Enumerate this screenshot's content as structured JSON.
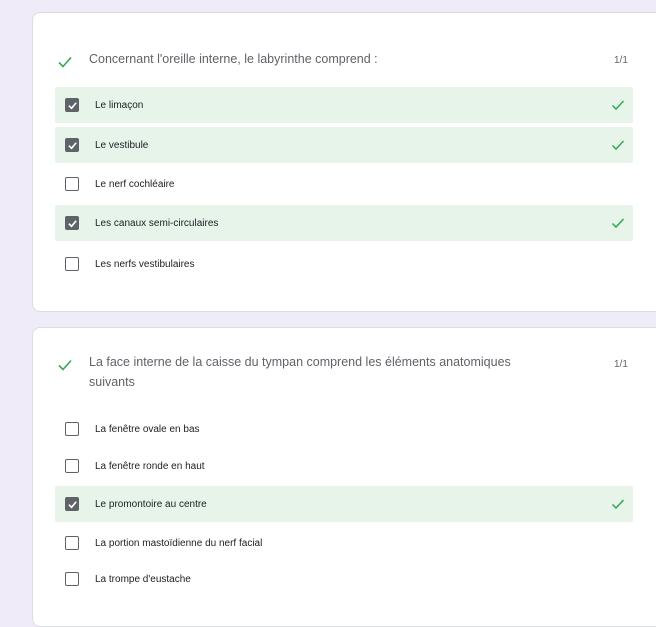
{
  "colors": {
    "correct_bg": "#e6f4ea",
    "check_green": "#34a853",
    "page_bg": "#f0ebf8"
  },
  "questions": [
    {
      "text": "Concernant l'oreille interne, le labyrinthe comprend :",
      "score": "1/1",
      "status_icon": "check-icon",
      "options": [
        {
          "label": "Le limaçon",
          "checked": true,
          "correct": true
        },
        {
          "label": "Le vestibule",
          "checked": true,
          "correct": true
        },
        {
          "label": "Le nerf cochléaire",
          "checked": false,
          "correct": false
        },
        {
          "label": "Les canaux semi-circulaires",
          "checked": true,
          "correct": true
        },
        {
          "label": "Les nerfs vestibulaires",
          "checked": false,
          "correct": false
        }
      ]
    },
    {
      "text": "La face interne de la caisse du tympan comprend les éléments anatomiques suivants",
      "score": "1/1",
      "status_icon": "check-icon",
      "options": [
        {
          "label": "La fenêtre ovale en bas",
          "checked": false,
          "correct": false
        },
        {
          "label": "La fenêtre ronde en haut",
          "checked": false,
          "correct": false
        },
        {
          "label": "Le promontoire au centre",
          "checked": true,
          "correct": true
        },
        {
          "label": "La portion mastoïdienne du nerf facial",
          "checked": false,
          "correct": false
        },
        {
          "label": "La trompe d'eustache",
          "checked": false,
          "correct": false
        }
      ]
    }
  ]
}
